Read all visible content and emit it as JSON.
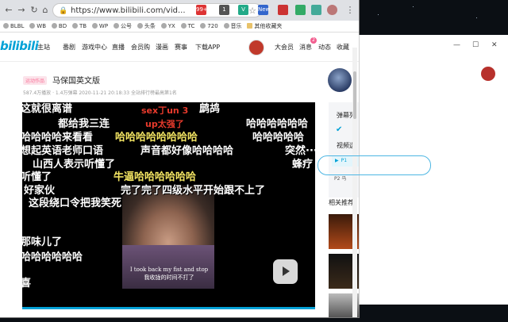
{
  "browser": {
    "url": "https://www.bilibili.com/vid...",
    "bookmarks": [
      "BLBL",
      "WB",
      "BD",
      "TB",
      "WP",
      "公号",
      "头条",
      "YX",
      "TC",
      "720",
      "音乐",
      "其他收藏夹"
    ],
    "extensions": [
      "99+",
      "1",
      "V",
      "New",
      "",
      "",
      ""
    ]
  },
  "header": {
    "logo": "bilibili",
    "nav": [
      "主站",
      "番剧",
      "游戏中心",
      "直播",
      "会员购",
      "漫画",
      "赛事",
      "下载APP"
    ],
    "right": [
      "大会员",
      "消息",
      "动态",
      "收藏"
    ],
    "message_badge": "2"
  },
  "video": {
    "tag": "运动作品",
    "title": "马保国英文版",
    "meta": "587.4万播放 · 1.4万弹幕  2020-11-21 20:18:33  全站排行榜最高第1名",
    "subtitle_en": "I took back my fist and stop",
    "subtitle_zh": "我收拢的时间不打了",
    "danmaku": [
      {
        "text": "这就很离谱",
        "cls": "w"
      },
      {
        "text": "sex丁un 3",
        "cls": "r s"
      },
      {
        "text": "鹧鸪",
        "cls": "w"
      },
      {
        "text": "都给我三连",
        "cls": "w"
      },
      {
        "text": "up太强了",
        "cls": "r s"
      },
      {
        "text": "哈哈哈哈哈哈",
        "cls": "w"
      },
      {
        "text": "哈哈哈哈来看看",
        "cls": "w"
      },
      {
        "text": "哈哈哈哈哈哈哈哈",
        "cls": "y"
      },
      {
        "text": "哈哈哈哈哈",
        "cls": "w"
      },
      {
        "text": "想起英语老师口语",
        "cls": "w"
      },
      {
        "text": "声音都好像哈哈哈哈",
        "cls": "w"
      },
      {
        "text": "突然···",
        "cls": "w"
      },
      {
        "text": "山西人表示听懂了",
        "cls": "w"
      },
      {
        "text": "蜂疗",
        "cls": "w"
      },
      {
        "text": "听懂了",
        "cls": "w"
      },
      {
        "text": "牛逼哈哈哈哈哈哈",
        "cls": "y"
      },
      {
        "text": "好家伙",
        "cls": "w"
      },
      {
        "text": "完了完了四级水平开始跟不上了",
        "cls": "w"
      },
      {
        "text": "这段绕口令把我笑死",
        "cls": "w"
      },
      {
        "text": "那味儿了",
        "cls": "w"
      },
      {
        "text": "哈哈哈哈哈哈",
        "cls": "w"
      },
      {
        "text": "喜",
        "cls": "w"
      }
    ],
    "progress": 1.0
  },
  "sidebar": {
    "danmaku_list": "弹幕列",
    "video_select": "视频选",
    "parts": [
      "P1",
      "P2 马"
    ],
    "recommend_head": "相关推荐"
  },
  "colors": {
    "accent": "#00a1d6",
    "pink": "#fb7299"
  }
}
